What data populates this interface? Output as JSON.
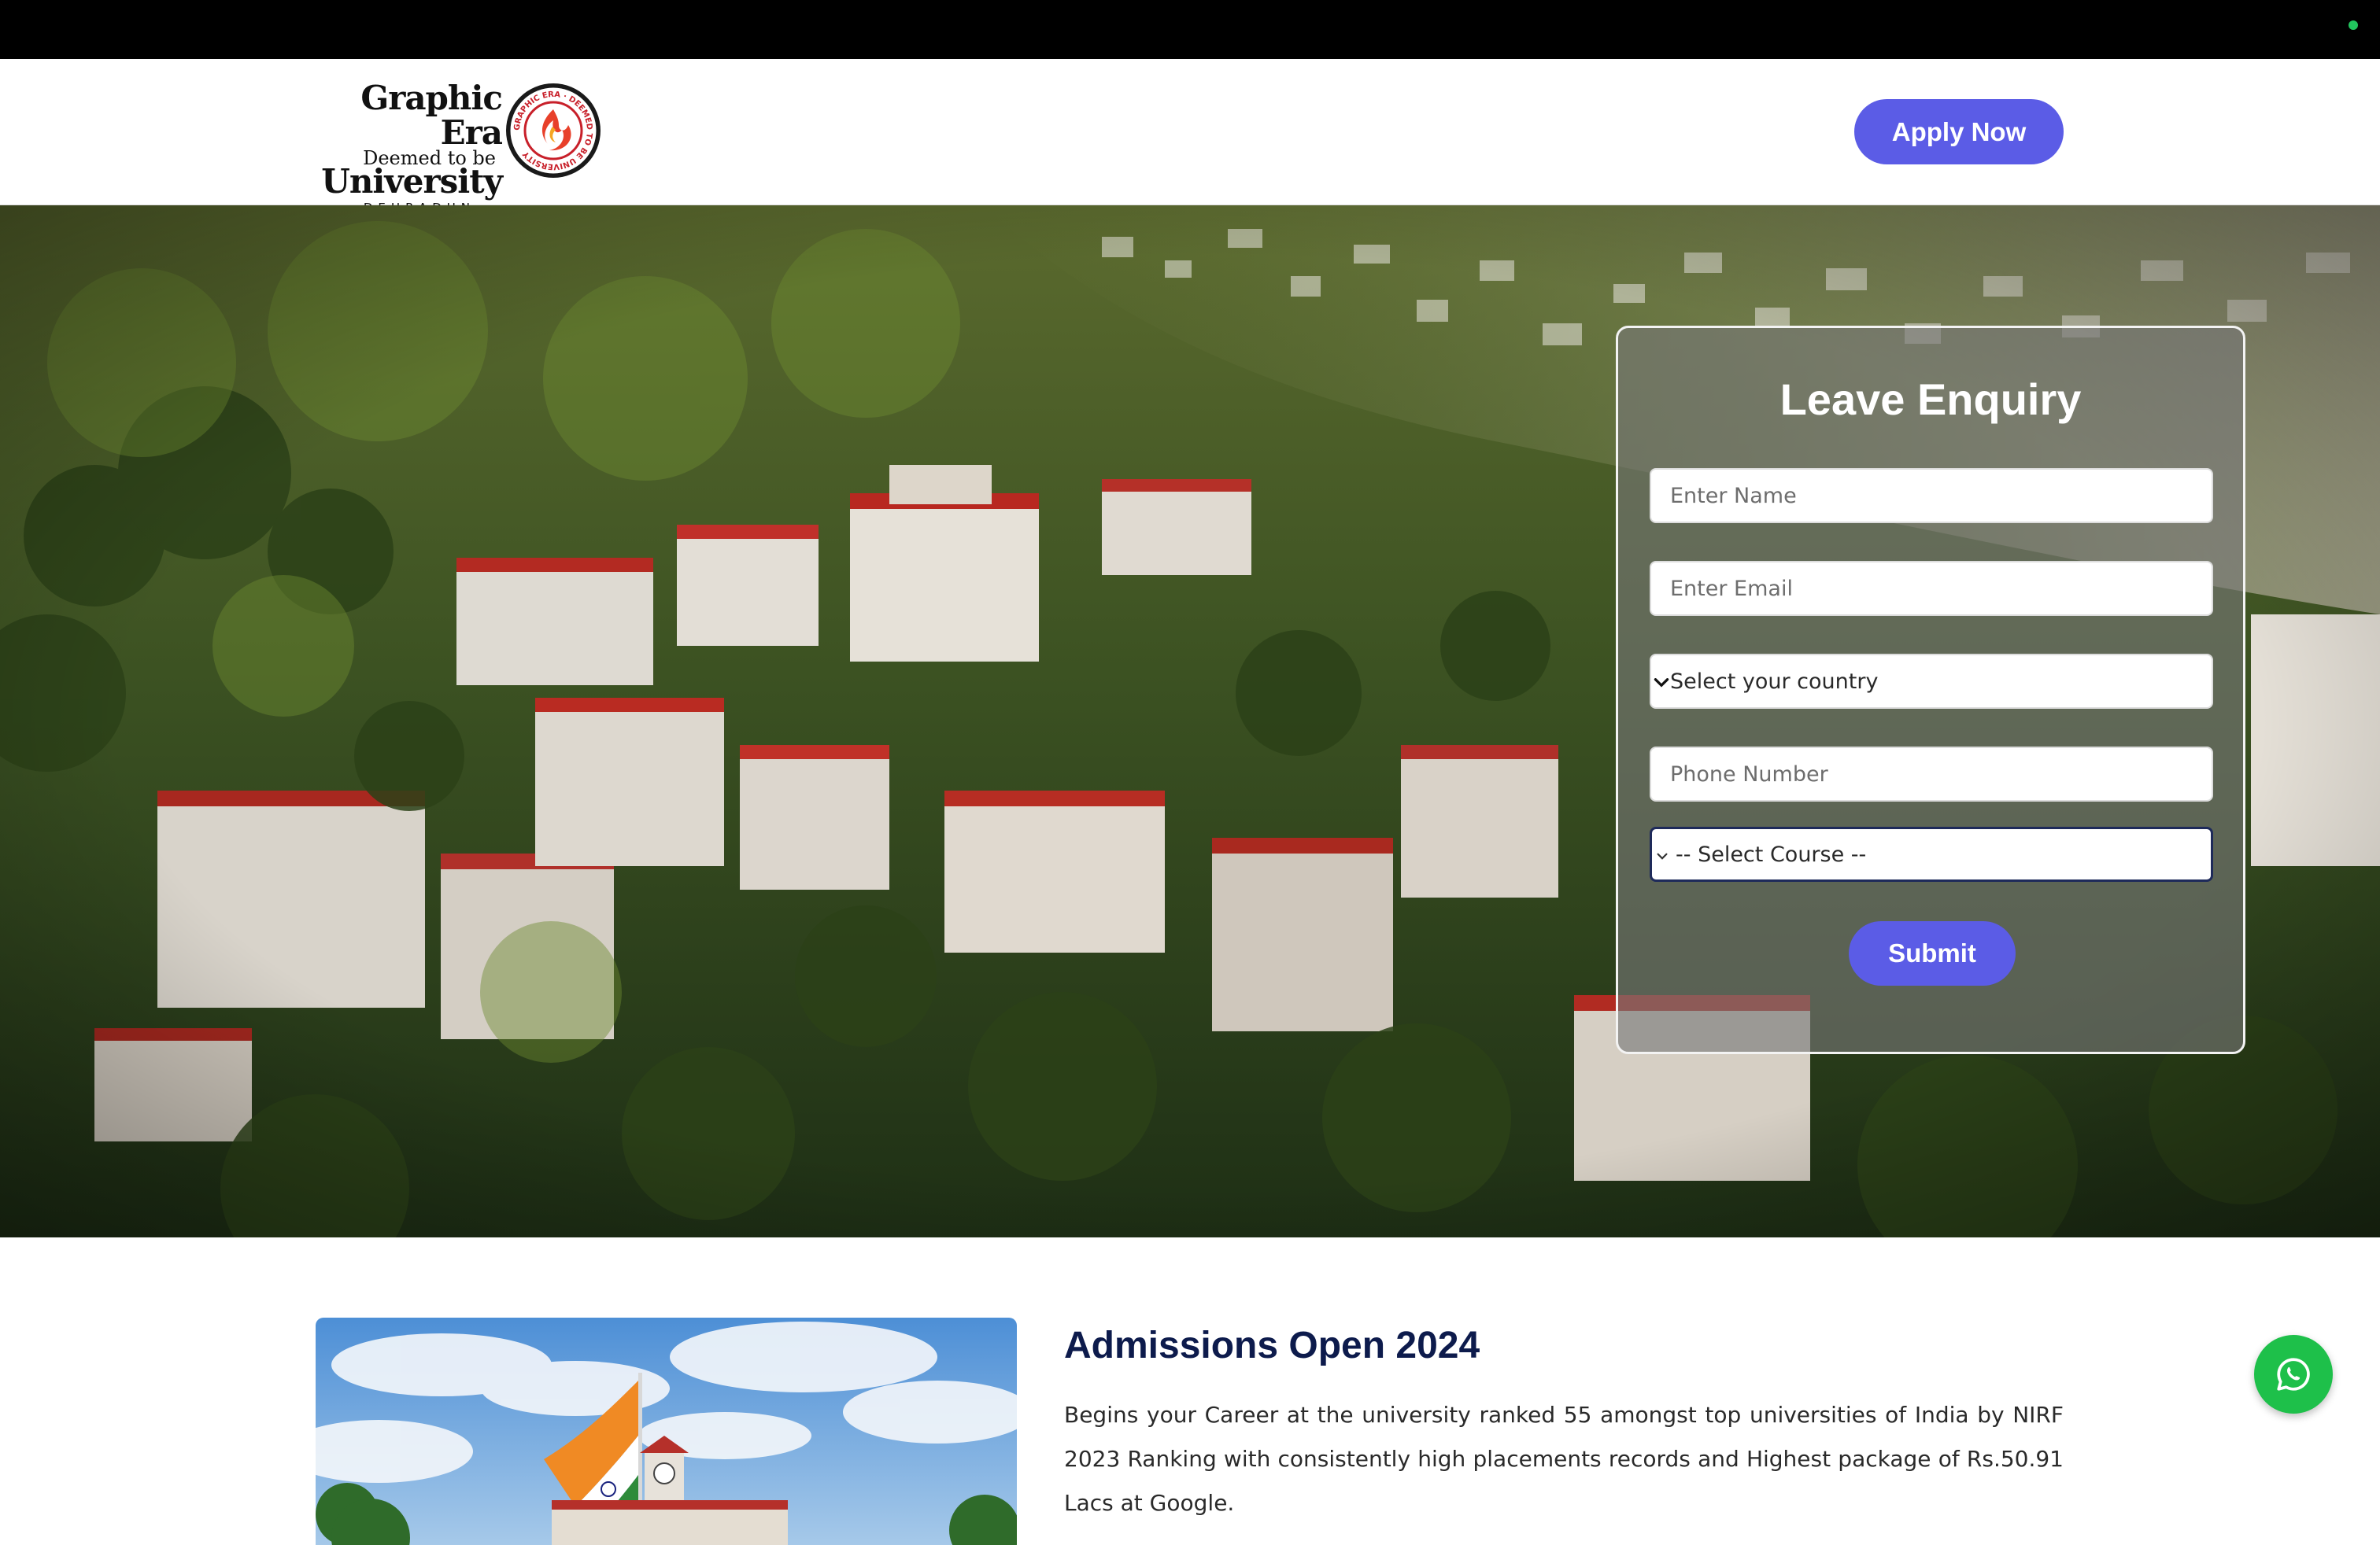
{
  "header": {
    "logo": {
      "line1": "Graphic Era",
      "line2": "Deemed to be",
      "line3": "University",
      "line4": "DEHRADUN",
      "seal_text": "GRAPHIC ERA · DEEMED TO BE UNIVERSITY"
    },
    "apply_label": "Apply Now"
  },
  "enquiry": {
    "title": "Leave Enquiry",
    "name_placeholder": "Enter Name",
    "email_placeholder": "Enter Email",
    "country_selected": "Select your country",
    "phone_placeholder": "Phone Number",
    "course_selected": "-- Select Course --",
    "submit_label": "Submit"
  },
  "admissions": {
    "title": "Admissions Open 2024",
    "text": "Begins your Career at the university ranked 55 amongst top universities of India by NIRF 2023 Ranking with consistently high placements records and Highest package of Rs.50.91 Lacs at Google."
  },
  "colors": {
    "accent": "#5b5ce6",
    "heading": "#0d1b4c",
    "whatsapp": "#1ec04a",
    "topbar": "#000000"
  },
  "icons": {
    "select_arrow": "chevron-down-icon",
    "chat": "whatsapp-icon"
  }
}
